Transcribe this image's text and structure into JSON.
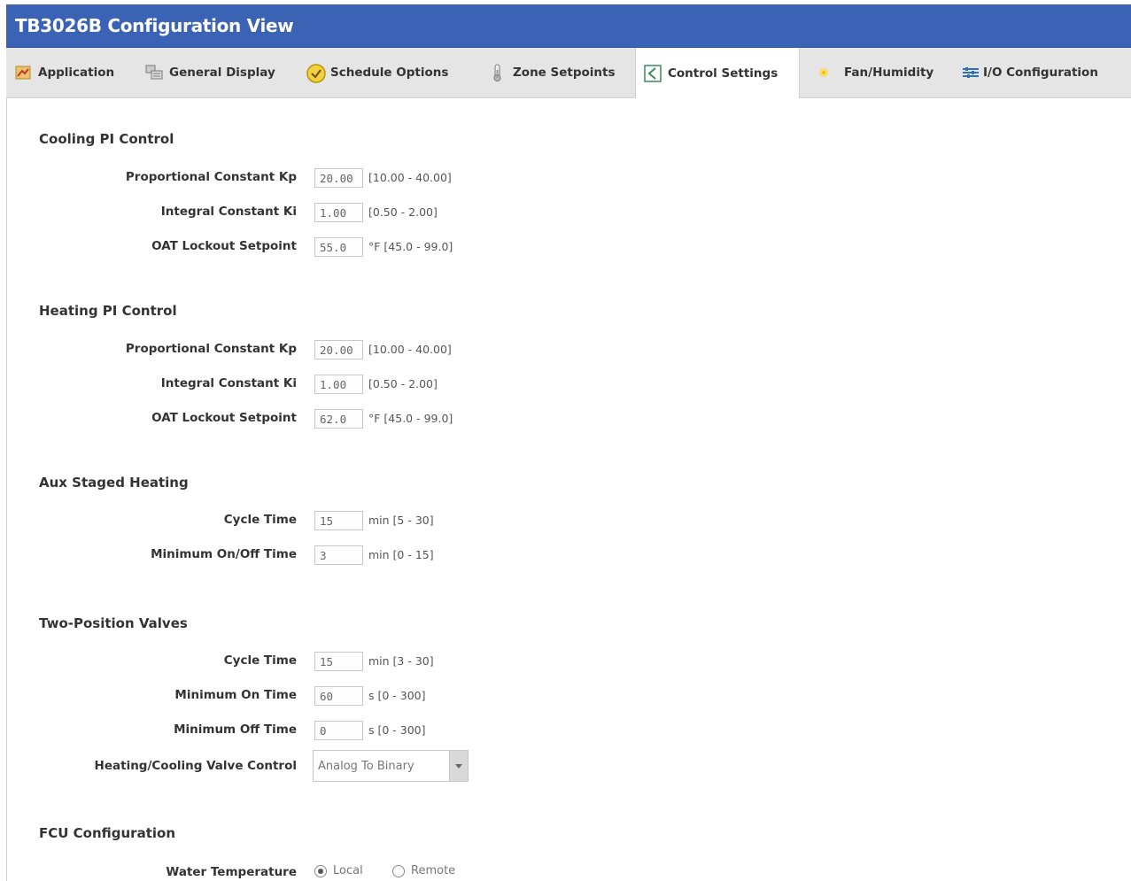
{
  "window": {
    "title": "TB3026B Configuration View"
  },
  "tabs": [
    {
      "label": "Application",
      "icon": "application-icon"
    },
    {
      "label": "General Display",
      "icon": "general-display-icon"
    },
    {
      "label": "Schedule Options",
      "icon": "schedule-clock-icon"
    },
    {
      "label": "Zone Setpoints",
      "icon": "thermometer-icon"
    },
    {
      "label": "Control Settings",
      "icon": "control-settings-icon",
      "active": true
    },
    {
      "label": "Fan/Humidity",
      "icon": "fan-icon"
    },
    {
      "label": "I/O Configuration",
      "icon": "io-configuration-icon"
    }
  ],
  "cooling": {
    "title": "Cooling PI Control",
    "kp": {
      "label": "Proportional Constant Kp",
      "value": "20.00",
      "range": "[10.00 - 40.00]"
    },
    "ki": {
      "label": "Integral Constant Ki",
      "value": "1.00",
      "range": "[0.50 - 2.00]"
    },
    "oat": {
      "label": "OAT Lockout Setpoint",
      "value": "55.0",
      "range": "°F [45.0 - 99.0]"
    }
  },
  "heating": {
    "title": "Heating PI Control",
    "kp": {
      "label": "Proportional Constant Kp",
      "value": "20.00",
      "range": "[10.00 - 40.00]"
    },
    "ki": {
      "label": "Integral Constant Ki",
      "value": "1.00",
      "range": "[0.50 - 2.00]"
    },
    "oat": {
      "label": "OAT Lockout Setpoint",
      "value": "62.0",
      "range": "°F [45.0 - 99.0]"
    }
  },
  "aux": {
    "title": "Aux Staged Heating",
    "cycle": {
      "label": "Cycle Time",
      "value": "15",
      "range": "min [5 - 30]"
    },
    "minonoff": {
      "label": "Minimum On/Off Time",
      "value": "3",
      "range": "min [0 - 15]"
    }
  },
  "valves": {
    "title": "Two-Position Valves",
    "cycle": {
      "label": "Cycle Time",
      "value": "15",
      "range": "min [3 - 30]"
    },
    "minon": {
      "label": "Minimum On Time",
      "value": "60",
      "range": "s [0 - 300]"
    },
    "minoff": {
      "label": "Minimum Off Time",
      "value": "0",
      "range": "s [0 - 300]"
    },
    "control": {
      "label": "Heating/Cooling Valve Control",
      "selected": "Analog To Binary"
    }
  },
  "fcu": {
    "title": "FCU Configuration",
    "water": {
      "label": "Water Temperature",
      "options": [
        "Local",
        "Remote"
      ],
      "selected": "Local"
    }
  },
  "colors": {
    "titlebar": "#3a63b5",
    "tabbar": "#e5e5e5"
  }
}
